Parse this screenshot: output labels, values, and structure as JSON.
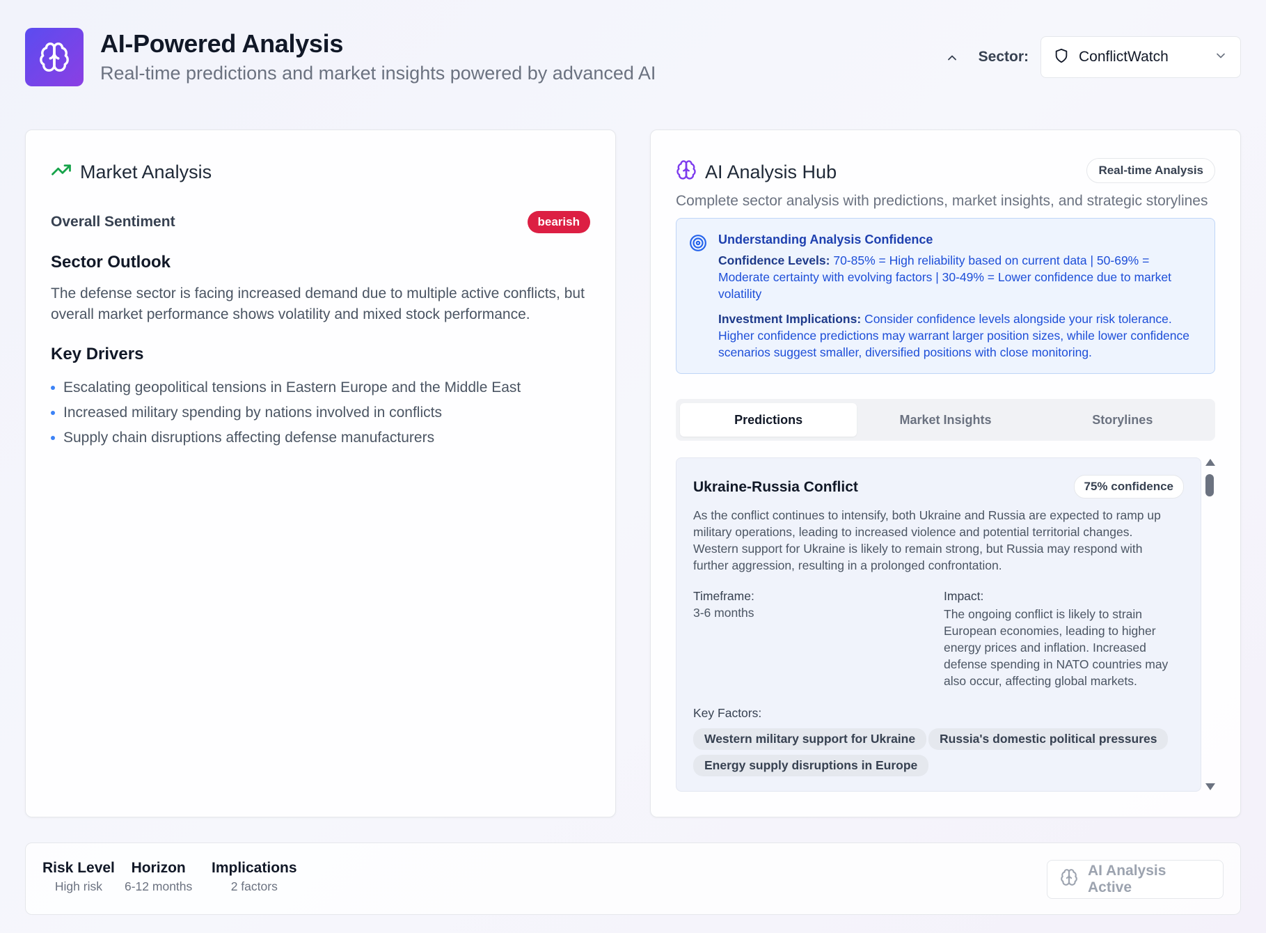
{
  "header": {
    "title": "AI-Powered Analysis",
    "subtitle": "Real-time predictions and market insights powered by advanced AI",
    "sector_label": "Sector:",
    "sector_value": "ConflictWatch"
  },
  "market_analysis": {
    "title": "Market Analysis",
    "sentiment_label": "Overall Sentiment",
    "sentiment_value": "bearish",
    "outlook_heading": "Sector Outlook",
    "outlook_text": "The defense sector is facing increased demand due to multiple active conflicts, but overall market performance shows volatility and mixed stock performance.",
    "drivers_heading": "Key Drivers",
    "drivers": [
      "Escalating geopolitical tensions in Eastern Europe and the Middle East",
      "Increased military spending by nations involved in conflicts",
      "Supply chain disruptions affecting defense manufacturers"
    ]
  },
  "hub": {
    "title": "AI Analysis Hub",
    "badge": "Real-time Analysis",
    "subtitle": "Complete sector analysis with predictions, market insights, and strategic storylines",
    "info": {
      "title": "Understanding Analysis Confidence",
      "levels_label": "Confidence Levels:",
      "levels_text": " 70-85% = High reliability based on current data | 50-69% = Moderate certainty with evolving factors | 30-49% = Lower confidence due to market volatility",
      "implications_label": "Investment Implications:",
      "implications_text": " Consider confidence levels alongside your risk tolerance. Higher confidence predictions may warrant larger position sizes, while lower confidence scenarios suggest smaller, diversified positions with close monitoring."
    },
    "tabs": [
      "Predictions",
      "Market Insights",
      "Storylines"
    ],
    "prediction": {
      "title": "Ukraine-Russia Conflict",
      "confidence": "75% confidence",
      "description": "As the conflict continues to intensify, both Ukraine and Russia are expected to ramp up military operations, leading to increased violence and potential territorial changes. Western support for Ukraine is likely to remain strong, but Russia may respond with further aggression, resulting in a prolonged confrontation.",
      "timeframe_label": "Timeframe:",
      "timeframe": "3-6 months",
      "impact_label": "Impact:",
      "impact": "The ongoing conflict is likely to strain European economies, leading to higher energy prices and inflation. Increased defense spending in NATO countries may also occur, affecting global markets.",
      "key_factors_label": "Key Factors:",
      "key_factors": [
        "Western military support for Ukraine",
        "Russia's domestic political pressures",
        "Energy supply disruptions in Europe"
      ]
    }
  },
  "footer": {
    "stats": [
      {
        "label": "Risk Level",
        "value": "High risk"
      },
      {
        "label": "Horizon",
        "value": "6-12 months"
      },
      {
        "label": "Implications",
        "value": "2 factors"
      }
    ],
    "status": "AI Analysis Active"
  },
  "colors": {
    "accent_gradient_start": "#5b4cf0",
    "accent_gradient_end": "#8b3fe3",
    "bearish": "#dc1f43",
    "trend_green": "#16a34a",
    "info_blue": "#1d4ed8"
  },
  "icons": {
    "logo": "brain-icon",
    "collapse": "chevron-up-icon",
    "sector": "shield-icon",
    "dropdown": "chevron-down-icon",
    "market": "trending-up-icon",
    "hub": "brain-icon",
    "info": "target-icon",
    "status": "brain-icon"
  }
}
